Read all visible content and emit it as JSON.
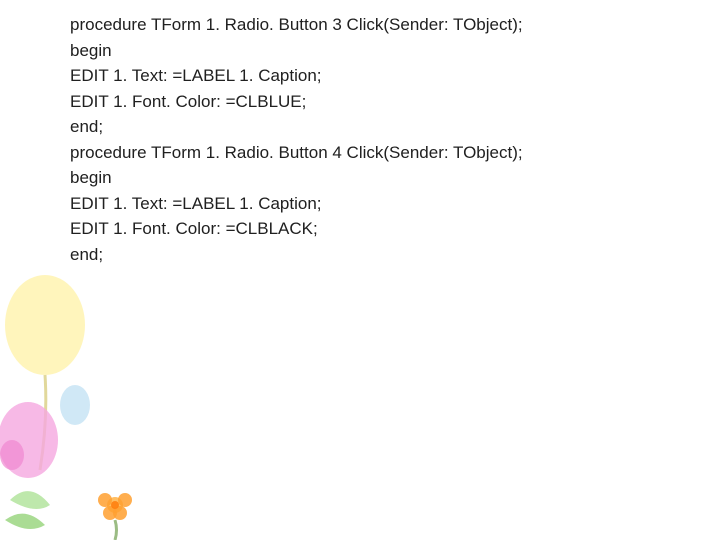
{
  "code_lines": [
    "procedure TForm 1. Radio. Button 3 Click(Sender: TObject);",
    "begin",
    "EDIT 1. Text: =LABEL 1. Caption;",
    "EDIT 1. Font. Color: =CLBLUE;",
    "end;",
    "procedure TForm 1. Radio. Button 4 Click(Sender: TObject);",
    "begin",
    "EDIT 1. Text: =LABEL 1. Caption;",
    "EDIT 1. Font. Color: =CLBLACK;",
    "end;"
  ]
}
